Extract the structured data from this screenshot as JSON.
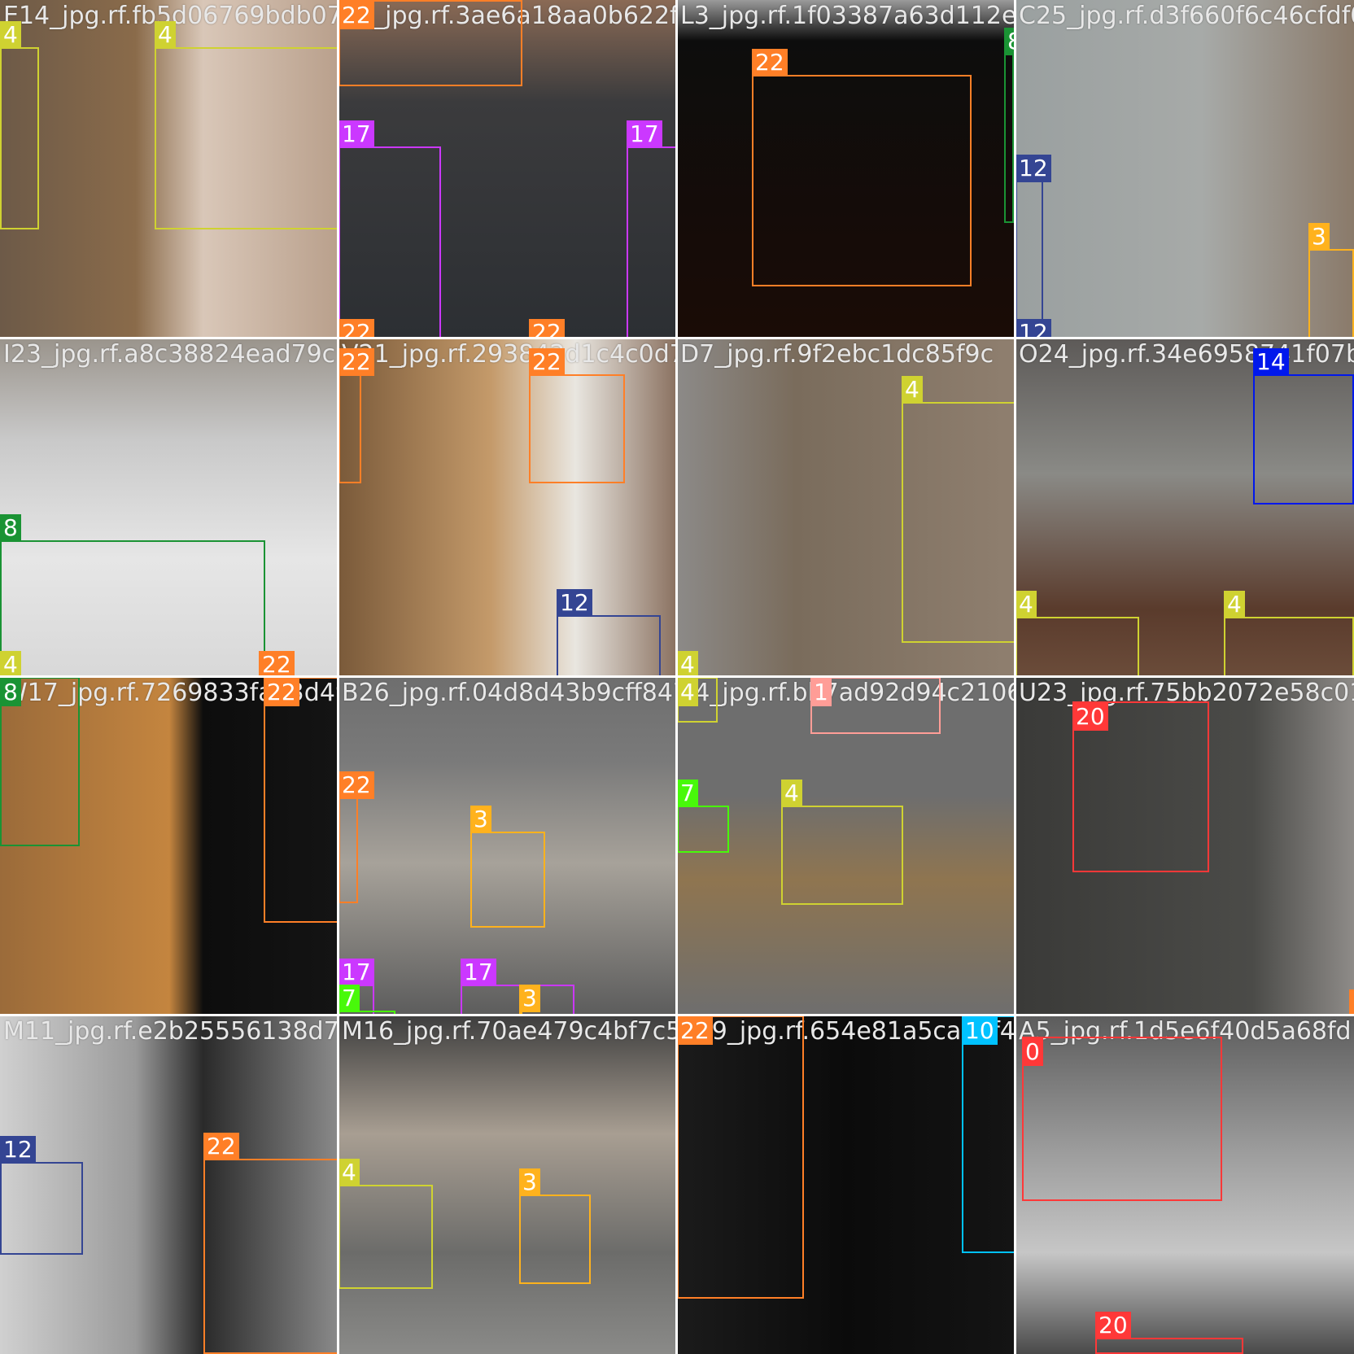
{
  "image": {
    "kind": "object-detection training batch mosaic",
    "grid": "4x4",
    "class_colors": {
      "0": "#ff3838",
      "1": "#ff9d97",
      "3": "#ffb21d",
      "4": "#cfd231",
      "7": "#48f90a",
      "8": "#1a9334",
      "10": "#00c2ff",
      "12": "#344593",
      "14": "#0018ec",
      "17": "#cb38ff",
      "20": "#ff3838",
      "22": "#ff7f27"
    }
  },
  "tiles": [
    {
      "filename": "E14_jpg.rf.fb5d06769bdb07",
      "boxes": [
        "4",
        "4"
      ]
    },
    {
      "filename": "22_jpg.rf.3ae6a18aa0b622f14483f56",
      "boxes": [
        "22",
        "17",
        "17",
        "22",
        "22"
      ]
    },
    {
      "filename": "L3_jpg.rf.1f03387a63d112e",
      "boxes": [
        "22",
        "8"
      ]
    },
    {
      "filename": "C25_jpg.rf.d3f660f6c46cfdf0a",
      "boxes": [
        "12",
        "3",
        "12"
      ]
    },
    {
      "filename": "I23_jpg.rf.a8c38824ead79c1",
      "boxes": [
        "8",
        "4",
        "22"
      ]
    },
    {
      "filename": "V21_jpg.rf.293842d1c4c0d79",
      "boxes": [
        "22",
        "22",
        "12"
      ]
    },
    {
      "filename": "D7_jpg.rf.9f2ebc1dc85f9c",
      "boxes": [
        "4",
        "4"
      ]
    },
    {
      "filename": "O24_jpg.rf.34e6958741f07b2",
      "boxes": [
        "14",
        "4",
        "4"
      ]
    },
    {
      "filename": "W17_jpg.rf.7269833fa03d49",
      "boxes": [
        "8",
        "22"
      ]
    },
    {
      "filename": "B26_jpg.rf.04d8d43b9cff8476",
      "boxes": [
        "22",
        "3",
        "17",
        "7",
        "17",
        "3"
      ]
    },
    {
      "filename": "F4_jpg.rf.bb7ad92d94c2106",
      "boxes": [
        "4",
        "1",
        "7",
        "4"
      ]
    },
    {
      "filename": "U23_jpg.rf.75bb2072e58c01",
      "boxes": [
        "20",
        "22"
      ]
    },
    {
      "filename": "M11_jpg.rf.e2b25556138d77",
      "boxes": [
        "12",
        "22"
      ]
    },
    {
      "filename": "M16_jpg.rf.70ae479c4bf7c576",
      "boxes": [
        "4",
        "3"
      ]
    },
    {
      "filename": "K19_jpg.rf.654e81a5caeef4",
      "boxes": [
        "22",
        "10"
      ]
    },
    {
      "filename": "A5_jpg.rf.1d5e6f40d5a68fd",
      "boxes": [
        "0",
        "20"
      ]
    }
  ]
}
